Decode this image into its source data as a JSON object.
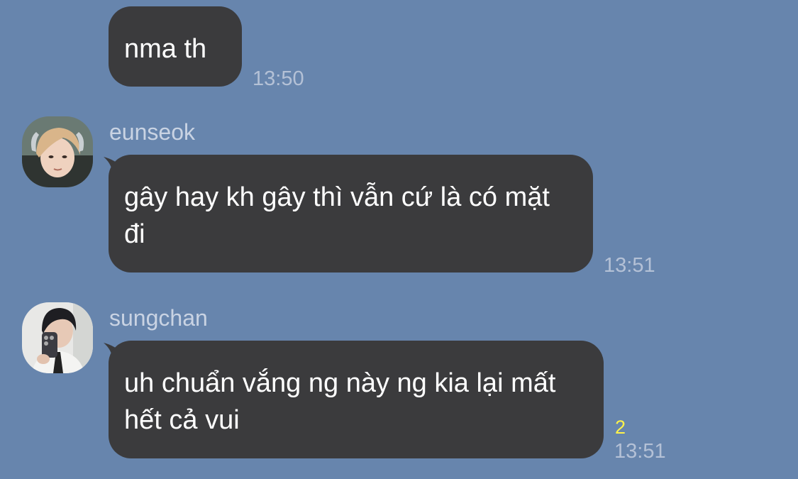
{
  "messages": [
    {
      "sender": "",
      "text": "nma th",
      "time": "13:50"
    },
    {
      "sender": "eunseok",
      "avatar_icon": "avatar-eunseok-photo",
      "text": "gây hay kh gây thì vẫn cứ là có mặt đi",
      "time": "13:51"
    },
    {
      "sender": "sungchan",
      "avatar_icon": "avatar-sungchan-photo",
      "text": "uh chuẩn vắng ng này ng kia lại mất hết cả vui",
      "read_count": "2",
      "time": "13:51"
    }
  ],
  "colors": {
    "background": "#6785ad",
    "bubble": "#3b3b3d",
    "bubble_text": "#ffffff",
    "timestamp": "#b4c1d6",
    "sender_name": "#c9d3e3",
    "read_count": "#fff34a"
  }
}
